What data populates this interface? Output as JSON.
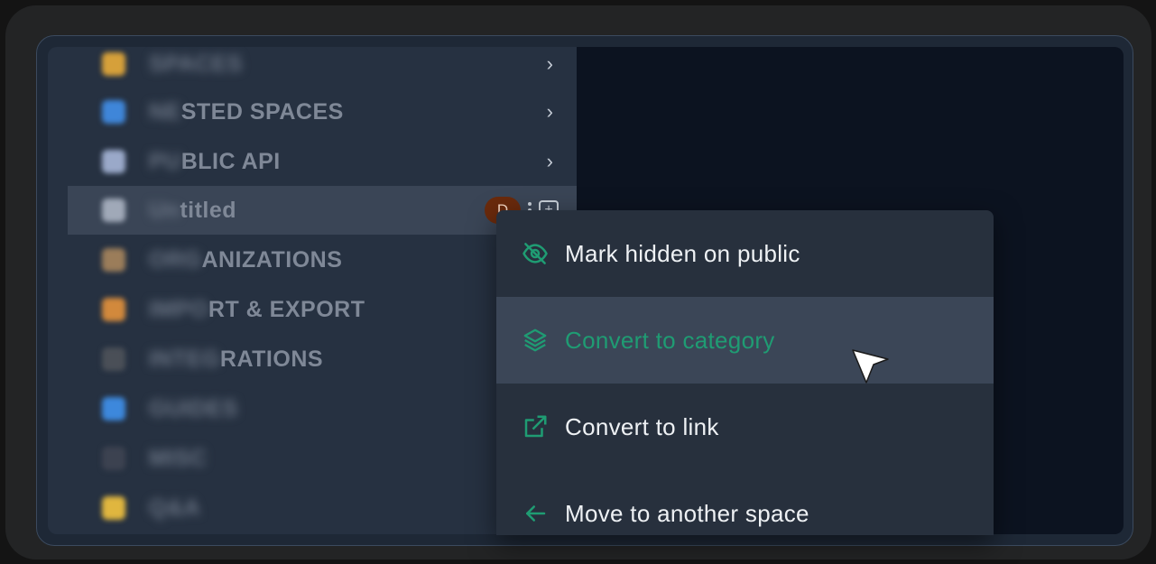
{
  "sidebar": {
    "items": [
      {
        "label_blur": "",
        "label_clear": "SPACES",
        "icon_color": "#d6a03a",
        "chevron": "›"
      },
      {
        "label_blur": "NE",
        "label_clear": "STED SPACES",
        "icon_color": "#3f86d9",
        "chevron": "›"
      },
      {
        "label_blur": "PU",
        "label_clear": "BLIC API",
        "icon_color": "#9aa9c9",
        "chevron": "›"
      },
      {
        "label_blur": "Un",
        "label_clear": "titled",
        "icon_color": "#a0a9b8",
        "active": true
      },
      {
        "label_blur": "ORG",
        "label_clear": "ANIZATIONS",
        "icon_color": "#9b7d5a"
      },
      {
        "label_blur": "IMPO",
        "label_clear": "RT & EXPORT",
        "icon_color": "#d2893c"
      },
      {
        "label_blur": "INTEG",
        "label_clear": "RATIONS",
        "icon_color": "#4a4f57"
      },
      {
        "label_blur": "",
        "label_clear": "GUIDES",
        "icon_color": "#3d88dc"
      },
      {
        "label_blur": "",
        "label_clear": "MISC",
        "icon_color": "#3c4250"
      },
      {
        "label_blur": "",
        "label_clear": "Q&A",
        "icon_color": "#e0b63f"
      }
    ],
    "active_row_avatar": "D"
  },
  "context_menu": {
    "accent_color": "#1f9c73",
    "items": [
      {
        "label": "Mark hidden on public",
        "icon": "eye-off-icon"
      },
      {
        "label": "Convert to category",
        "icon": "layers-icon",
        "hovered": true
      },
      {
        "label": "Convert to link",
        "icon": "external-link-icon"
      },
      {
        "label": "Move to another space",
        "icon": "arrow-left-icon"
      }
    ]
  }
}
